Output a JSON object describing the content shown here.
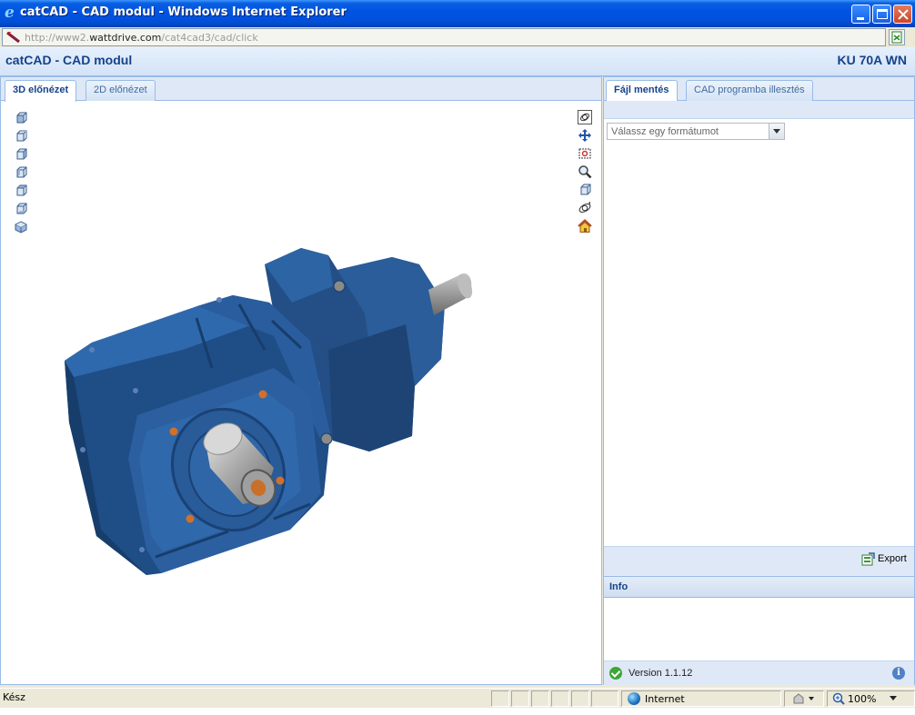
{
  "window": {
    "title": "catCAD - CAD modul - Windows Internet Explorer",
    "buttons": [
      "minimize",
      "maximize",
      "close"
    ]
  },
  "address_bar": {
    "url_prefix": "http://www2.",
    "url_domain": "wattdrive.com",
    "url_path": "/cat4cad3/cad/click"
  },
  "app": {
    "title": "catCAD - CAD modul",
    "model": "KU 70A WN"
  },
  "viewer": {
    "tabs": [
      {
        "label": "3D előnézet",
        "active": true
      },
      {
        "label": "2D előnézet",
        "active": false
      }
    ],
    "view_tools": [
      "view-front-icon",
      "view-back-icon",
      "view-left-icon",
      "view-right-icon",
      "view-top-icon",
      "view-bottom-icon",
      "view-isometric-icon"
    ],
    "nav_tools": [
      "rotate-icon",
      "pan-icon",
      "zoom-window-icon",
      "zoom-icon",
      "fit-view-icon",
      "orbit-icon",
      "home-icon"
    ],
    "colors": {
      "gear_body": "#22558f",
      "shaft": "#b0b0b0",
      "flange_bolts": "#d76b1f"
    }
  },
  "export_panel": {
    "tabs": [
      {
        "label": "Fájl mentés",
        "active": true
      },
      {
        "label": "CAD programba illesztés",
        "active": false
      }
    ],
    "format_placeholder": "Válassz egy formátumot",
    "export_label": "Export",
    "info_title": "Info",
    "version": "Version 1.1.12"
  },
  "statusbar": {
    "status": "Kész",
    "zone": "Internet",
    "zoom": "100%"
  }
}
